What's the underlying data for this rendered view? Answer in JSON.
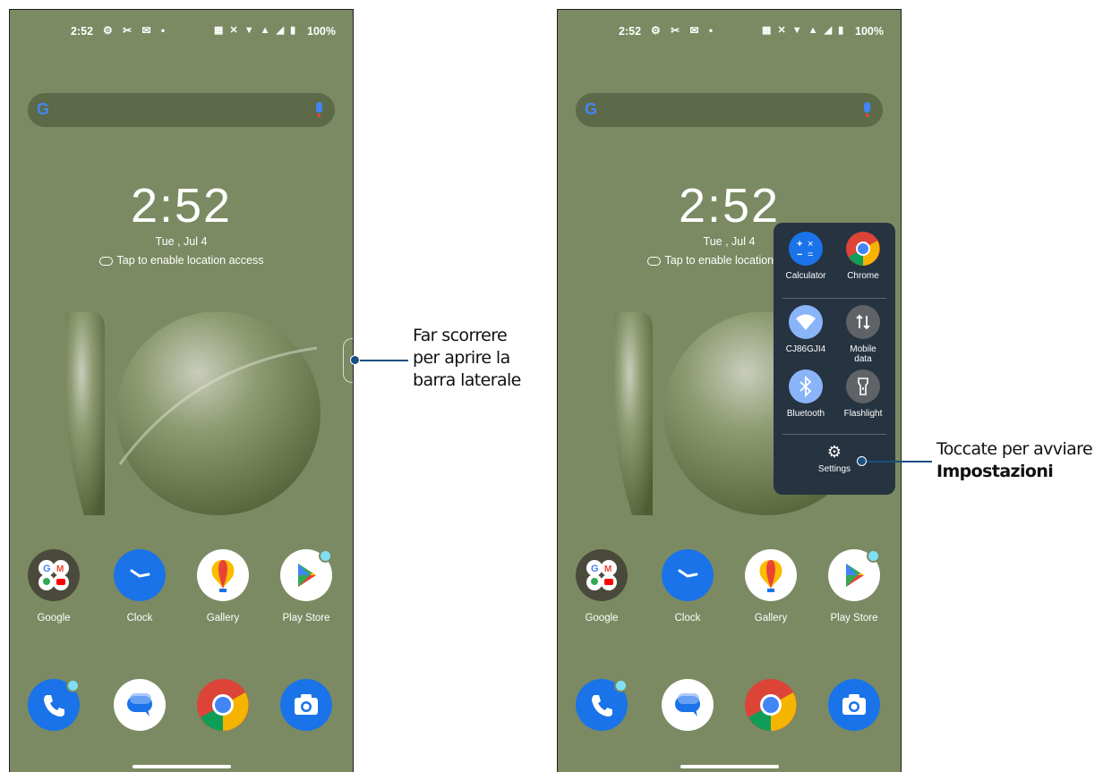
{
  "status": {
    "time": "2:52",
    "battery": "100%"
  },
  "home": {
    "clock": "2:52",
    "date": "Tue , Jul 4",
    "location_prompt": "Tap to enable location access",
    "apps": [
      {
        "label": "Google",
        "icon": "google-folder-icon"
      },
      {
        "label": "Clock",
        "icon": "clock-icon"
      },
      {
        "label": "Gallery",
        "icon": "gallery-icon"
      },
      {
        "label": "Play Store",
        "icon": "play-store-icon"
      }
    ],
    "dock": [
      {
        "icon": "phone-icon"
      },
      {
        "icon": "messages-icon"
      },
      {
        "icon": "chrome-icon"
      },
      {
        "icon": "camera-icon"
      }
    ]
  },
  "sidebar": {
    "apps": [
      {
        "label": "Calculator",
        "icon": "calculator-icon"
      },
      {
        "label": "Chrome",
        "icon": "chrome-icon"
      }
    ],
    "toggles": [
      {
        "label": "CJ86GJI4",
        "icon": "wifi-icon"
      },
      {
        "label": "Mobile data",
        "icon": "mobile-data-icon"
      },
      {
        "label": "Bluetooth",
        "icon": "bluetooth-icon"
      },
      {
        "label": "Flashlight",
        "icon": "flashlight-icon"
      }
    ],
    "settings_label": "Settings"
  },
  "annotations": {
    "left_line1": "Far scorrere",
    "left_line2": "per aprire la",
    "left_line3": "barra laterale",
    "right_line1": "Toccate per avviare",
    "right_line2": "Impostazioni"
  },
  "colors": {
    "wallpaper": "#7b8a62",
    "panel": "#263340",
    "annotation_line": "#1a4f82"
  }
}
